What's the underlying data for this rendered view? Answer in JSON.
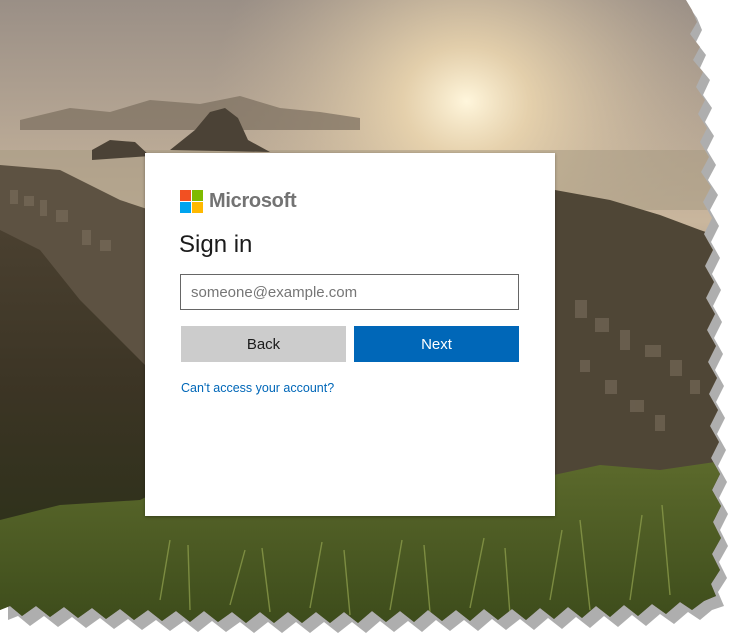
{
  "brand": {
    "name": "Microsoft",
    "logo_colors": [
      "#f25022",
      "#7fba00",
      "#00a4ef",
      "#ffb900"
    ]
  },
  "signin": {
    "title": "Sign in",
    "email_placeholder": "someone@example.com",
    "email_value": "",
    "back_label": "Back",
    "next_label": "Next",
    "help_link": "Can't access your account?"
  },
  "colors": {
    "accent": "#0067b8",
    "secondary_button": "#cccccc"
  }
}
